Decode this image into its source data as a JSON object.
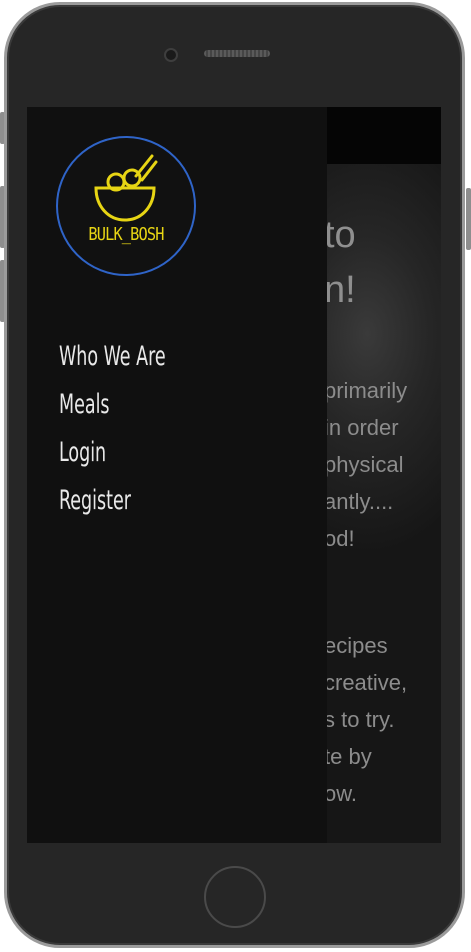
{
  "logo": {
    "text": "BULK_BOSH",
    "accent": "#e7d514",
    "ring": "#2f64c8"
  },
  "nav": {
    "items": [
      {
        "label": "Who We Are"
      },
      {
        "label": "Meals"
      },
      {
        "label": "Login"
      },
      {
        "label": "Register"
      }
    ]
  },
  "hero": {
    "title_line1": "to",
    "title_line2": "n!",
    "body": [
      "primarily",
      "in order",
      "physical",
      "antly....",
      "od!",
      "ecipes",
      "creative,",
      "s to try.",
      "te by",
      "ow."
    ]
  },
  "colors": {
    "screen_bg": "#0e0e0e",
    "drawer_bg": "#101010",
    "phone_body": "#262626"
  }
}
